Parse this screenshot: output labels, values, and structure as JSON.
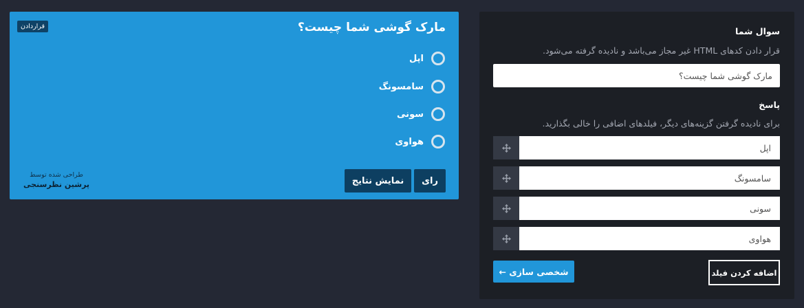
{
  "preview": {
    "title": "مارک گوشی شما چیست؟",
    "embed_badge": "قراردادن",
    "options": [
      {
        "label": "اپل"
      },
      {
        "label": "سامسونگ"
      },
      {
        "label": "سونی"
      },
      {
        "label": "هواوی"
      }
    ],
    "vote_label": "رای",
    "results_label": "نمایش نتایج",
    "credit_small": "طراحی شده توسط",
    "credit_name": "پرشین نظرسنجی"
  },
  "editor": {
    "question_title": "سوال شما",
    "question_desc": "قرار دادن کدهای HTML غیر مجاز می‌باشد و نادیده گرفته می‌شود.",
    "question_value": "مارک گوشی شما چیست؟",
    "answer_title": "پاسخ",
    "answer_desc": "برای نادیده گرفتن گزینه‌های دیگر، فیلدهای اضافی را خالی بگذارید.",
    "answers": [
      "اپل",
      "سامسونگ",
      "سونی",
      "هواوی"
    ],
    "add_field_label": "اضافه کردن فیلد",
    "customize_label": "شخصی سازی ←"
  },
  "colors": {
    "background": "#242834",
    "panel": "#1c1f25",
    "accent": "#2196d9",
    "dark_button": "#0d3f61"
  },
  "icons": {
    "drag_handle": "move-arrows-icon"
  }
}
